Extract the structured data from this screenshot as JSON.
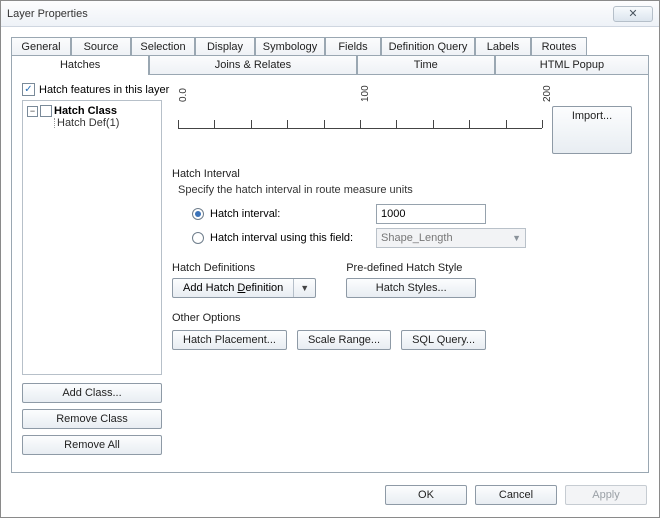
{
  "window": {
    "title": "Layer Properties",
    "close_glyph": "✕"
  },
  "tabs_row1": [
    "General",
    "Source",
    "Selection",
    "Display",
    "Symbology",
    "Fields",
    "Definition Query",
    "Labels",
    "Routes"
  ],
  "tabs_row2": [
    "Hatches",
    "Joins & Relates",
    "Time",
    "HTML Popup"
  ],
  "active_tab": "Hatches",
  "checkbox": {
    "label": "Hatch features in this layer",
    "checked": true
  },
  "tree": {
    "root": {
      "label": "Hatch Class",
      "expanded": true,
      "checked": false
    },
    "child": {
      "label": "Hatch Def(1)"
    }
  },
  "left_buttons": {
    "add": "Add Class...",
    "remove": "Remove Class",
    "remove_all": "Remove All"
  },
  "ruler": {
    "ticks": [
      "0.0",
      "100",
      "200"
    ]
  },
  "import_btn": "Import...",
  "interval": {
    "title": "Hatch Interval",
    "subtitle": "Specify the hatch interval in route measure units",
    "opt1": "Hatch interval:",
    "opt1_value": "1000",
    "opt2": "Hatch interval using this field:",
    "opt2_value": "Shape_Length",
    "selected": "opt1"
  },
  "defs": {
    "title": "Hatch Definitions",
    "btn": "Add Hatch Definition",
    "underline_index": 10
  },
  "styles": {
    "title": "Pre-defined Hatch Style",
    "btn": "Hatch Styles..."
  },
  "other": {
    "title": "Other Options",
    "placement": "Hatch Placement...",
    "scale": "Scale Range...",
    "sql": "SQL Query..."
  },
  "footer": {
    "ok": "OK",
    "cancel": "Cancel",
    "apply": "Apply"
  }
}
